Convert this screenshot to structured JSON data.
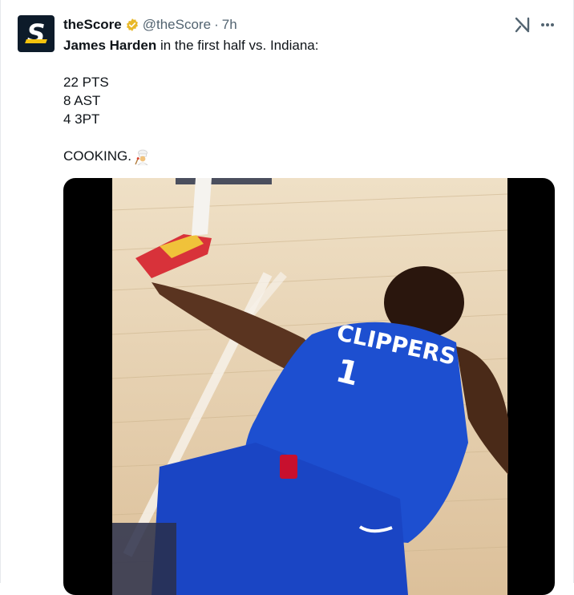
{
  "tweet": {
    "author": {
      "display_name": "theScore",
      "handle": "@theScore",
      "separator": "·",
      "time": "7h",
      "avatar_letter": "S",
      "verified_color": "#e8b829"
    },
    "lines": [
      {
        "bold": "James Harden",
        "rest": " in the first half vs. Indiana:"
      },
      {
        "text": "22 PTS"
      },
      {
        "text": "8 AST"
      },
      {
        "text": "4 3PT"
      },
      {
        "text": "COOKING."
      }
    ],
    "icons": {
      "grok": "grok-icon",
      "more": "more-icon",
      "emoji": "chef-emoji"
    },
    "media": {
      "type": "video",
      "jersey_text": "CLIPPERS",
      "jersey_number": "1",
      "jersey_color": "#1d4fd0",
      "floor_color": "#e8d2b0"
    }
  }
}
